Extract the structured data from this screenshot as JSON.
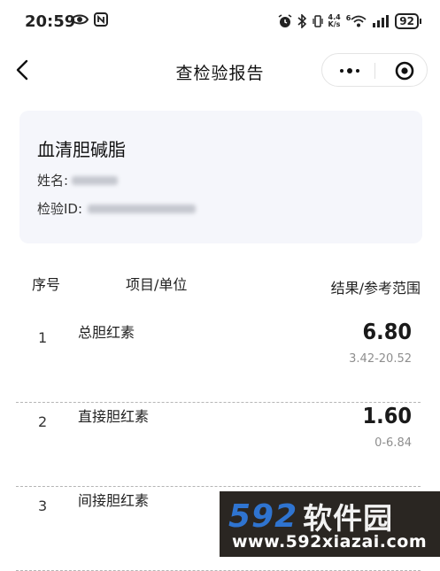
{
  "status_bar": {
    "time": "20:59",
    "network_speed_top": "4.4",
    "network_speed_unit": "K/s",
    "wifi_label": "6",
    "battery": "92"
  },
  "nav": {
    "title": "查检验报告"
  },
  "report": {
    "title": "血清胆碱脂",
    "name_label": "姓名:",
    "id_label": "检验ID:"
  },
  "table": {
    "headers": {
      "no": "序号",
      "item": "项目/单位",
      "result": "结果/参考范围"
    },
    "rows": [
      {
        "no": "1",
        "name": "总胆红素",
        "value": "6.80",
        "range": "3.42-20.52"
      },
      {
        "no": "2",
        "name": "直接胆红素",
        "value": "1.60",
        "range": "0-6.84"
      },
      {
        "no": "3",
        "name": "间接胆红素",
        "value": "",
        "range": ""
      }
    ]
  },
  "watermark": {
    "number": "592",
    "name": "软件园",
    "url": "www.592xiazai.com"
  }
}
